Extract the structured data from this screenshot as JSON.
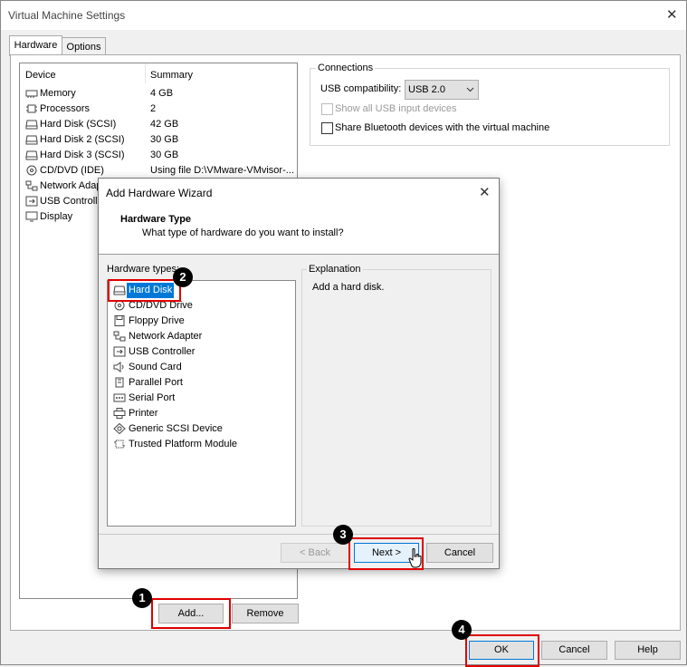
{
  "window": {
    "title": "Virtual Machine Settings",
    "close": "✕"
  },
  "tabs": [
    {
      "label": "Hardware"
    },
    {
      "label": "Options"
    }
  ],
  "device_list": {
    "headers": {
      "device": "Device",
      "summary": "Summary"
    },
    "rows": [
      {
        "device": "Memory",
        "summary": "4 GB",
        "icon": "memory-icon"
      },
      {
        "device": "Processors",
        "summary": "2",
        "icon": "processor-icon"
      },
      {
        "device": "Hard Disk (SCSI)",
        "summary": "42 GB",
        "icon": "hard-disk-icon"
      },
      {
        "device": "Hard Disk 2 (SCSI)",
        "summary": "30 GB",
        "icon": "hard-disk-icon"
      },
      {
        "device": "Hard Disk 3 (SCSI)",
        "summary": "30 GB",
        "icon": "hard-disk-icon"
      },
      {
        "device": "CD/DVD (IDE)",
        "summary": "Using file D:\\VMware-VMvisor-...",
        "icon": "cd-dvd-icon"
      },
      {
        "device": "Network Adapter",
        "summary": "",
        "icon": "network-icon"
      },
      {
        "device": "USB Controller",
        "summary": "",
        "icon": "usb-icon"
      },
      {
        "device": "Display",
        "summary": "",
        "icon": "display-icon"
      }
    ]
  },
  "connections": {
    "legend": "Connections",
    "usb_label": "USB compatibility:",
    "usb_value": "USB 2.0",
    "show_all_usb": "Show all USB input devices",
    "share_bluetooth": "Share Bluetooth devices with the virtual machine"
  },
  "buttons": {
    "add": "Add...",
    "remove": "Remove",
    "ok": "OK",
    "cancel": "Cancel",
    "help": "Help"
  },
  "wizard": {
    "title": "Add Hardware Wizard",
    "close": "✕",
    "heading": "Hardware Type",
    "subheading": "What type of hardware do you want to install?",
    "types_label": "Hardware types:",
    "types": [
      {
        "label": "Hard Disk",
        "icon": "hard-disk-icon"
      },
      {
        "label": "CD/DVD Drive",
        "icon": "cd-dvd-icon"
      },
      {
        "label": "Floppy Drive",
        "icon": "floppy-icon"
      },
      {
        "label": "Network Adapter",
        "icon": "network-icon"
      },
      {
        "label": "USB Controller",
        "icon": "usb-icon"
      },
      {
        "label": "Sound Card",
        "icon": "speaker-icon"
      },
      {
        "label": "Parallel Port",
        "icon": "parallel-port-icon"
      },
      {
        "label": "Serial Port",
        "icon": "serial-port-icon"
      },
      {
        "label": "Printer",
        "icon": "printer-icon"
      },
      {
        "label": "Generic SCSI Device",
        "icon": "scsi-icon"
      },
      {
        "label": "Trusted Platform Module",
        "icon": "tpm-icon"
      }
    ],
    "explanation_legend": "Explanation",
    "explanation_text": "Add a hard disk.",
    "back": "< Back",
    "next": "Next >",
    "cancel": "Cancel"
  },
  "markers": {
    "m1": "1",
    "m2": "2",
    "m3": "3",
    "m4": "4"
  },
  "colors": {
    "selection": "#0078d7",
    "highlight_box": "#e00000"
  }
}
